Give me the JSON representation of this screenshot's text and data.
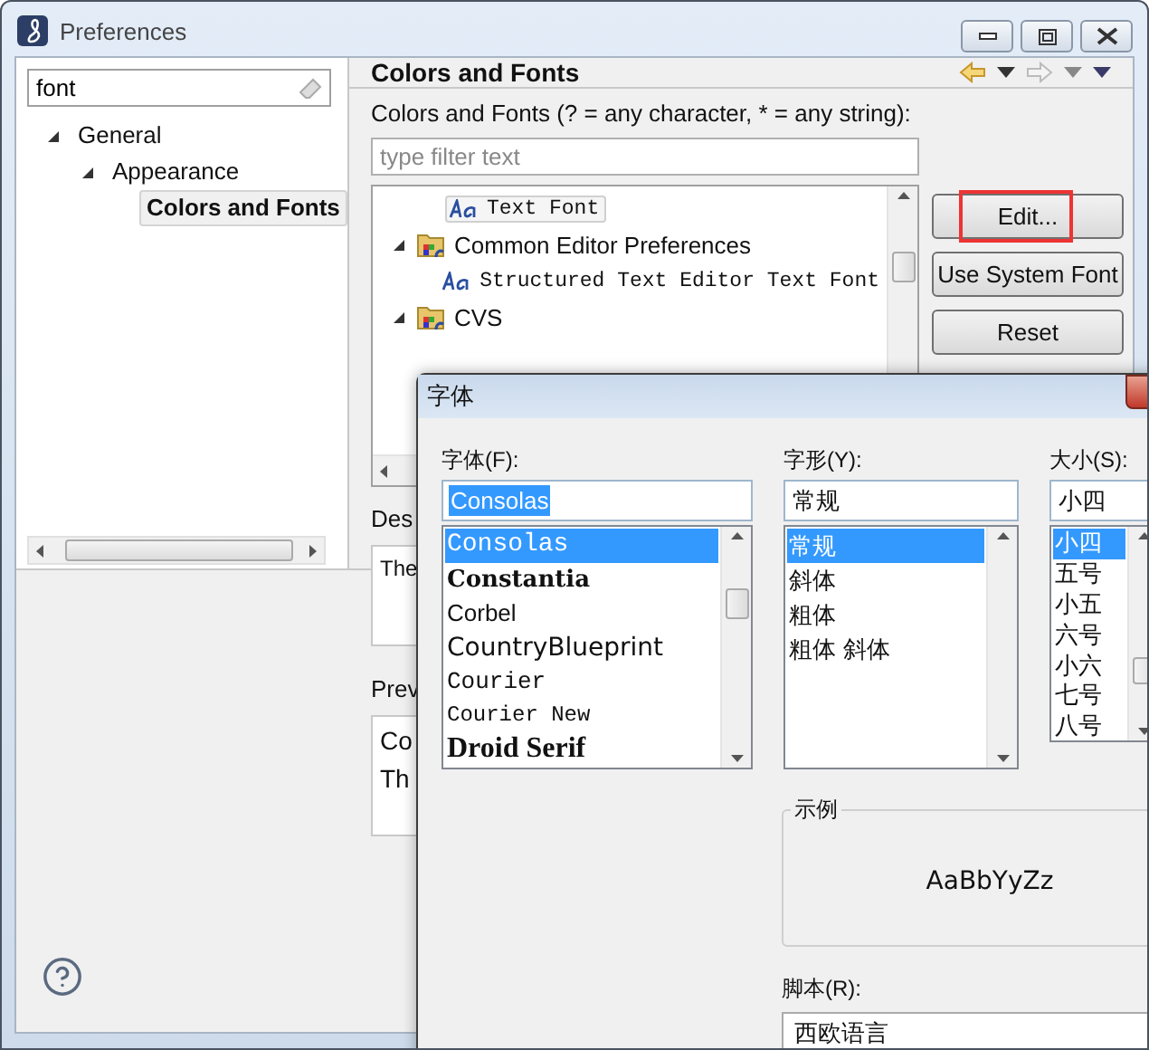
{
  "window": {
    "title": "Preferences"
  },
  "sidebar": {
    "search": {
      "value": "font"
    },
    "tree": [
      {
        "label": "General",
        "expanded": true,
        "selected": false,
        "children": [
          {
            "label": "Appearance",
            "expanded": true,
            "selected": false,
            "children": [
              {
                "label": "Colors and Fonts",
                "selected": true
              }
            ]
          }
        ]
      }
    ]
  },
  "page": {
    "title": "Colors and Fonts",
    "filter_label": "Colors and Fonts (? = any character, * = any string):",
    "filter": {
      "placeholder": "type filter text"
    },
    "tree": [
      {
        "label": "Text Font",
        "kind": "font",
        "selected": true
      },
      {
        "label": "Common Editor Preferences",
        "kind": "category",
        "expanded": true,
        "selected": false,
        "children": [
          {
            "label": "Structured Text Editor Text Font",
            "kind": "font",
            "selected": false
          }
        ]
      },
      {
        "label": "CVS",
        "kind": "category",
        "expanded": true,
        "selected": false
      }
    ],
    "buttons": [
      {
        "label": "Edit...",
        "highlighted": true
      },
      {
        "label": "Use System Font",
        "highlighted": false
      },
      {
        "label": "Reset",
        "highlighted": false
      }
    ],
    "description_label": "Des",
    "description": "The",
    "preview_label": "Prev",
    "preview_lines": [
      "Co",
      "Th"
    ]
  },
  "font_dialog": {
    "title": "字体",
    "font": {
      "label": "字体(F):",
      "value": "Consolas",
      "items": [
        {
          "label": "Consolas",
          "selected": true
        },
        {
          "label": "Constantia",
          "selected": false
        },
        {
          "label": "Corbel",
          "selected": false
        },
        {
          "label": "CountryBlueprint",
          "selected": false
        },
        {
          "label": "Courier",
          "selected": false
        },
        {
          "label": "Courier New",
          "selected": false
        },
        {
          "label": "Droid Serif",
          "selected": false
        }
      ]
    },
    "style": {
      "label": "字形(Y):",
      "value": "常规",
      "items": [
        {
          "label": "常规",
          "selected": true
        },
        {
          "label": "斜体",
          "selected": false
        },
        {
          "label": "粗体",
          "selected": false
        },
        {
          "label": "粗体 斜体",
          "selected": false
        }
      ]
    },
    "size": {
      "label": "大小(S):",
      "value": "小四",
      "items": [
        {
          "label": "小四",
          "selected": true
        },
        {
          "label": "五号",
          "selected": false
        },
        {
          "label": "小五",
          "selected": false
        },
        {
          "label": "六号",
          "selected": false
        },
        {
          "label": "小六",
          "selected": false
        },
        {
          "label": "七号",
          "selected": false
        },
        {
          "label": "八号",
          "selected": false
        }
      ]
    },
    "sample": {
      "label": "示例",
      "text": "AaBbYyZz"
    },
    "script": {
      "label": "脚本(R):",
      "value": "西欧语言"
    }
  }
}
